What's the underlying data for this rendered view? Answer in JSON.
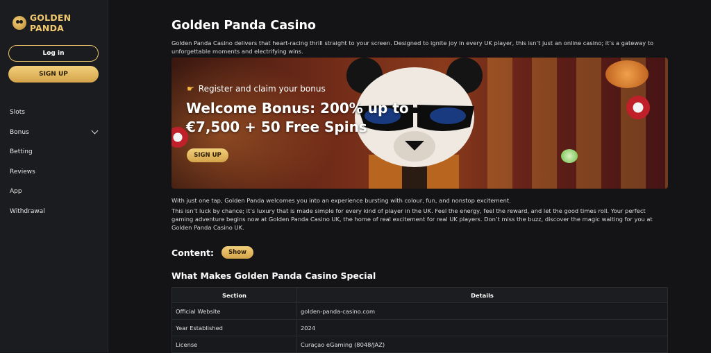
{
  "brand": {
    "name": "GOLDEN PANDA"
  },
  "sidebar": {
    "login_label": "Log in",
    "signup_label": "SIGN UP",
    "items": [
      {
        "label": "Slots"
      },
      {
        "label": "Bonus"
      },
      {
        "label": "Betting"
      },
      {
        "label": "Reviews"
      },
      {
        "label": "App"
      },
      {
        "label": "Withdrawal"
      }
    ]
  },
  "main": {
    "title": "Golden Panda Casino",
    "intro": "Golden Panda Casino delivers that heart-racing thrill straight to your screen. Designed to ignite joy in every UK player, this isn’t just an online casino; it’s a gateway to unforgettable moments and electrifying wins.",
    "banner": {
      "subtitle": "Register and claim your bonus",
      "headline": "Welcome Bonus: 200% up to €7,500 + 50 Free Spins",
      "button_label": "SIGN UP"
    },
    "para1": "With just one tap, Golden Panda welcomes you into an experience bursting with colour, fun, and nonstop excitement.",
    "para2": "This isn’t luck by chance; it’s luxury that is made simple for every kind of player in the UK. Feel the energy, feel the reward, and let the good times roll. Your perfect gaming adventure begins now at Golden Panda Casino UK, the home of real excitement for real UK players. Don’t miss the buzz, discover the magic waiting for you at Golden Panda Casino UK.",
    "content_label": "Content:",
    "show_label": "Show",
    "section_title": "What Makes Golden Panda Casino Special",
    "table": {
      "headers": [
        "Section",
        "Details"
      ],
      "rows": [
        [
          "Official Website",
          "golden-panda-casino.com"
        ],
        [
          "Year Established",
          "2024"
        ],
        [
          "License",
          "Curaçao eGaming (8048/JAZ)"
        ]
      ]
    }
  },
  "colors": {
    "accent": "#e9c46a",
    "background": "#141416",
    "sidebar": "#1b1c1f",
    "link": "#e9b949"
  }
}
